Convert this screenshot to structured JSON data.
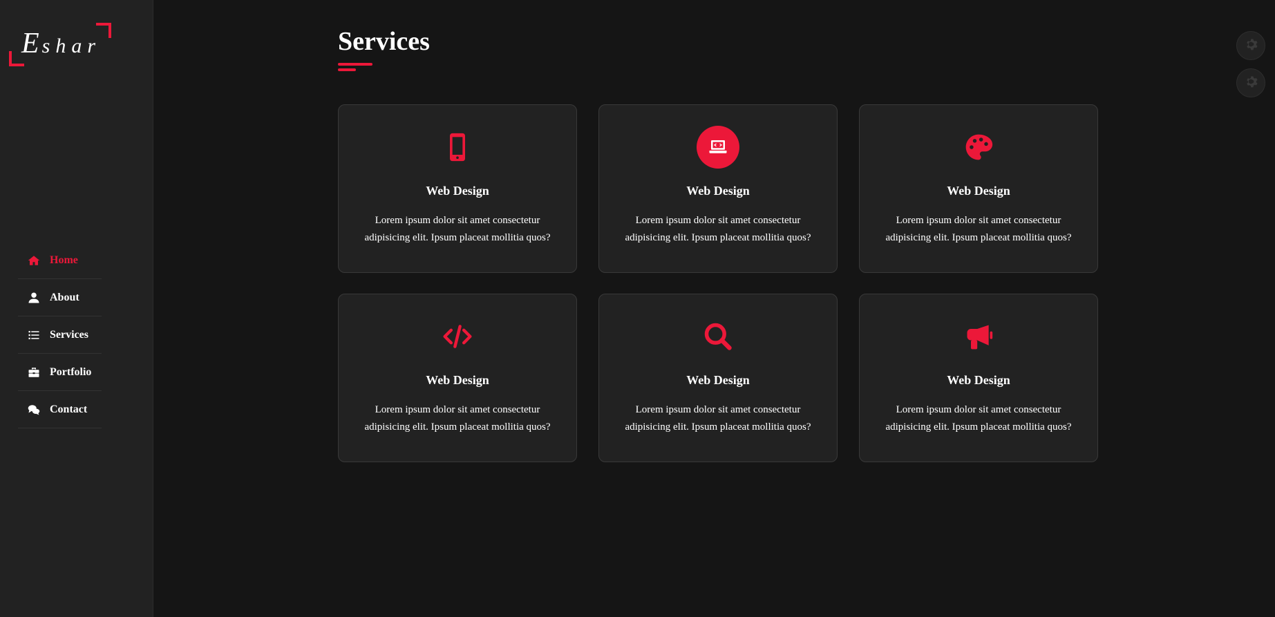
{
  "brand": {
    "logo_initial": "E",
    "logo_rest": "shar",
    "accent": "#ec1839"
  },
  "nav": {
    "items": [
      {
        "label": "Home",
        "icon": "home-icon",
        "active": true
      },
      {
        "label": "About",
        "icon": "user-icon",
        "active": false
      },
      {
        "label": "Services",
        "icon": "list-icon",
        "active": false
      },
      {
        "label": "Portfolio",
        "icon": "briefcase-icon",
        "active": false
      },
      {
        "label": "Contact",
        "icon": "comments-icon",
        "active": false
      }
    ]
  },
  "main": {
    "title": "Services",
    "cards": [
      {
        "icon": "mobile-icon",
        "title": "Web Design",
        "text": "Lorem ipsum dolor sit amet consectetur adipisicing elit. Ipsum placeat mollitia quos?"
      },
      {
        "icon": "laptop-code-icon",
        "title": "Web Design",
        "text": "Lorem ipsum dolor sit amet consectetur adipisicing elit. Ipsum placeat mollitia quos?"
      },
      {
        "icon": "palette-icon",
        "title": "Web Design",
        "text": "Lorem ipsum dolor sit amet consectetur adipisicing elit. Ipsum placeat mollitia quos?"
      },
      {
        "icon": "code-icon",
        "title": "Web Design",
        "text": "Lorem ipsum dolor sit amet consectetur adipisicing elit. Ipsum placeat mollitia quos?"
      },
      {
        "icon": "search-icon",
        "title": "Web Design",
        "text": "Lorem ipsum dolor sit amet consectetur adipisicing elit. Ipsum placeat mollitia quos?"
      },
      {
        "icon": "bullhorn-icon",
        "title": "Web Design",
        "text": "Lorem ipsum dolor sit amet consectetur adipisicing elit. Ipsum placeat mollitia quos?"
      }
    ]
  },
  "toolbar": {
    "buttons": [
      {
        "icon": "gear-icon"
      },
      {
        "icon": "gear-icon"
      }
    ]
  }
}
